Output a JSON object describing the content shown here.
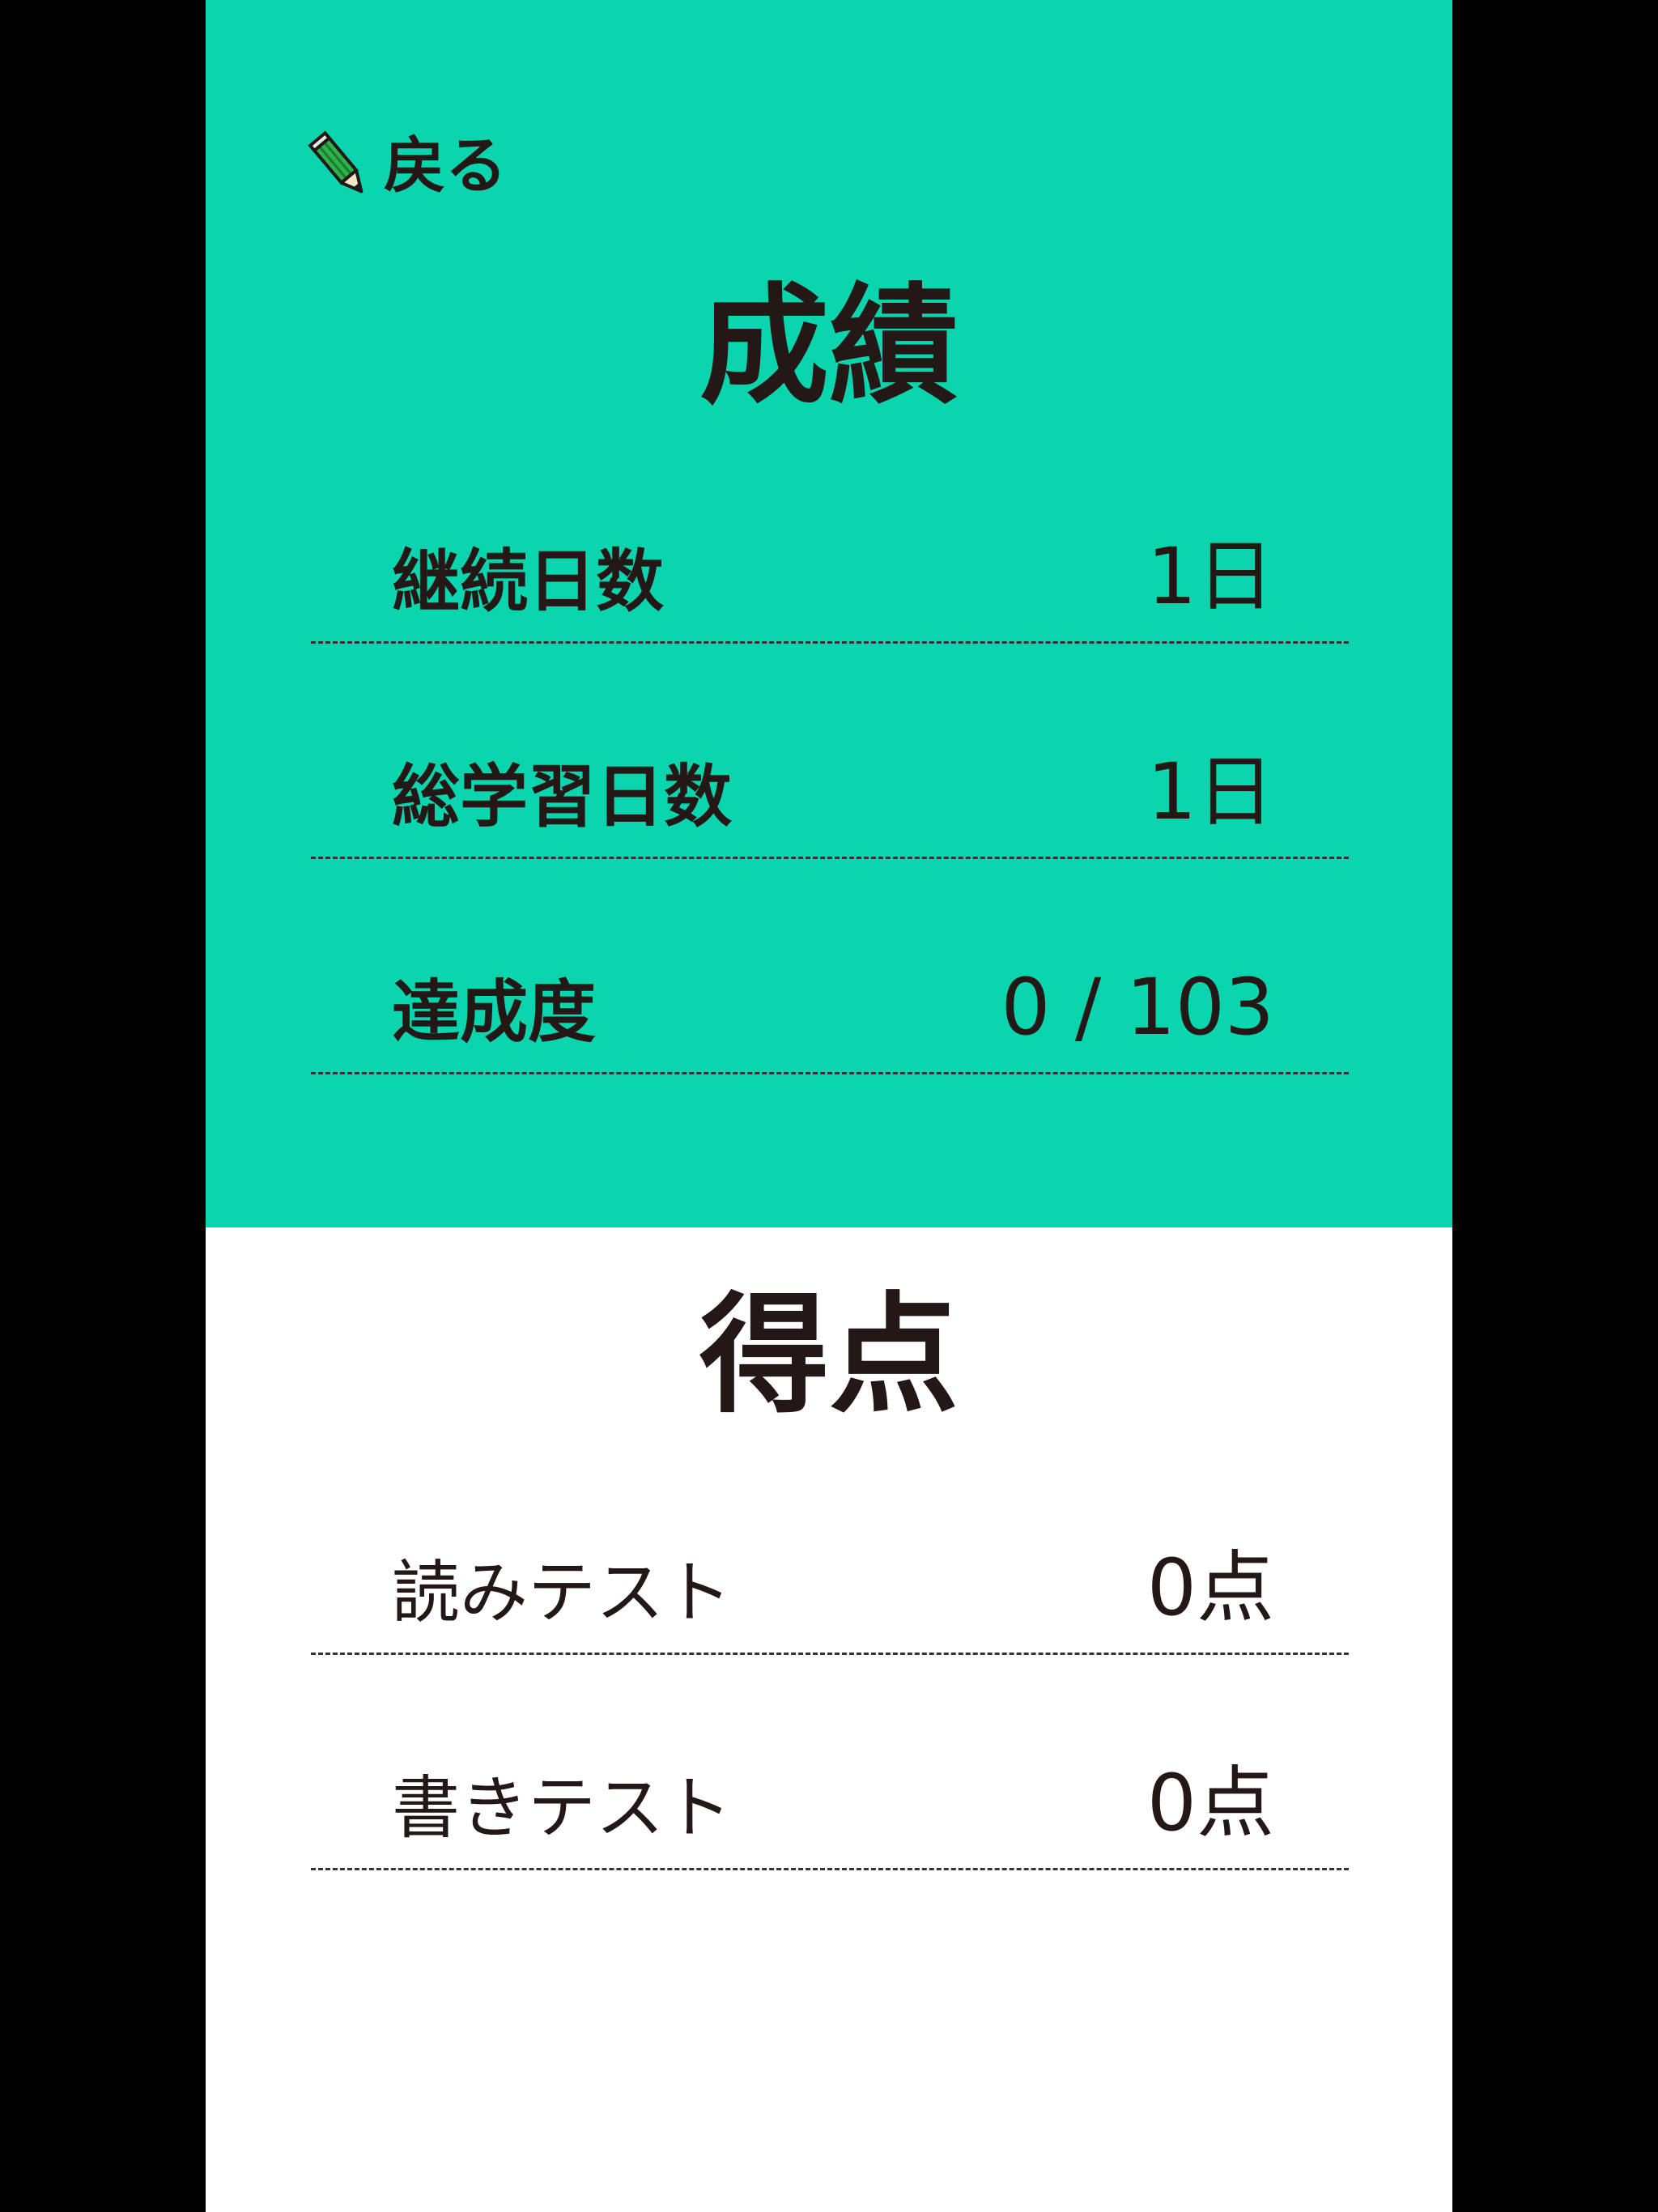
{
  "colors": {
    "accent": "#0bd5af",
    "background": "#ffffff",
    "frame": "#000000",
    "text": "#231815"
  },
  "header": {
    "back_label": "戻る",
    "back_icon": "pencil-icon"
  },
  "results": {
    "title": "成績",
    "rows": [
      {
        "label": "継続日数",
        "value": "1日"
      },
      {
        "label": "総学習日数",
        "value": "1日"
      },
      {
        "label": "達成度",
        "value": "0 / 103"
      }
    ]
  },
  "score": {
    "title": "得点",
    "rows": [
      {
        "label": "読みテスト",
        "value": "0点"
      },
      {
        "label": "書きテスト",
        "value": "0点"
      }
    ]
  }
}
